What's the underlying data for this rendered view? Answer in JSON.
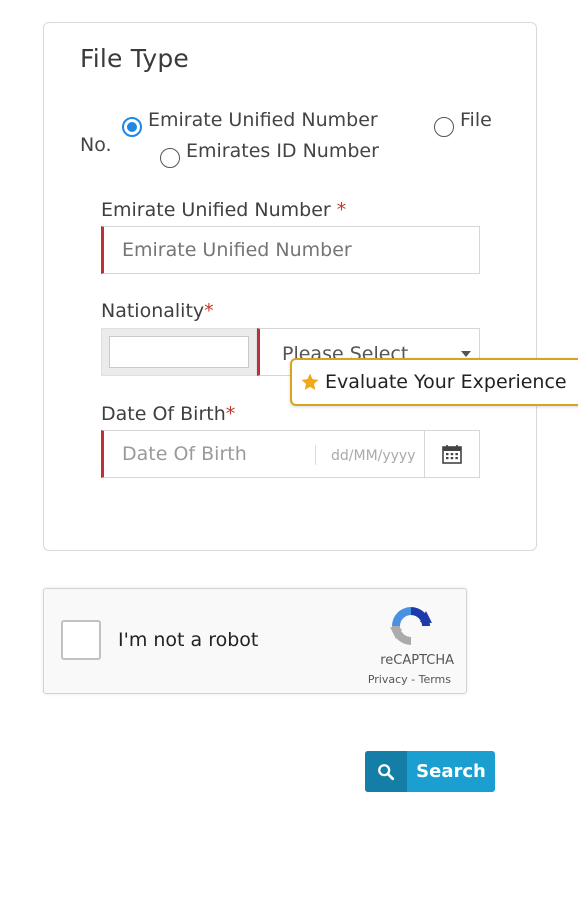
{
  "form": {
    "title": "File Type",
    "radios": [
      {
        "label": "Emirate Unified Number",
        "checked": true
      },
      {
        "label": "File",
        "checked": false
      },
      {
        "label": "Emirates ID Number",
        "checked": false
      }
    ],
    "file_no_suffix": "No.",
    "unified_number": {
      "label": "Emirate Unified Number",
      "required_mark": "*",
      "placeholder": "Emirate Unified Number",
      "value": ""
    },
    "nationality": {
      "label": "Nationality",
      "required_mark": "*",
      "select_value": "Please Select"
    },
    "dob": {
      "label": "Date Of Birth",
      "required_mark": "*",
      "placeholder": "Date Of Birth",
      "format_hint": "dd/MM/yyyy"
    }
  },
  "evaluate": {
    "label": "Evaluate Your Experience",
    "icon": "star-icon",
    "color": "#d9a320"
  },
  "captcha": {
    "label": "I'm not a robot",
    "brand": "reCAPTCHA",
    "links": "Privacy - Terms"
  },
  "search": {
    "label": "Search",
    "icon": "search-icon",
    "color": "#1a9fd0"
  },
  "colors": {
    "required": "#c0303a",
    "radio_selected": "#1e88e5"
  }
}
